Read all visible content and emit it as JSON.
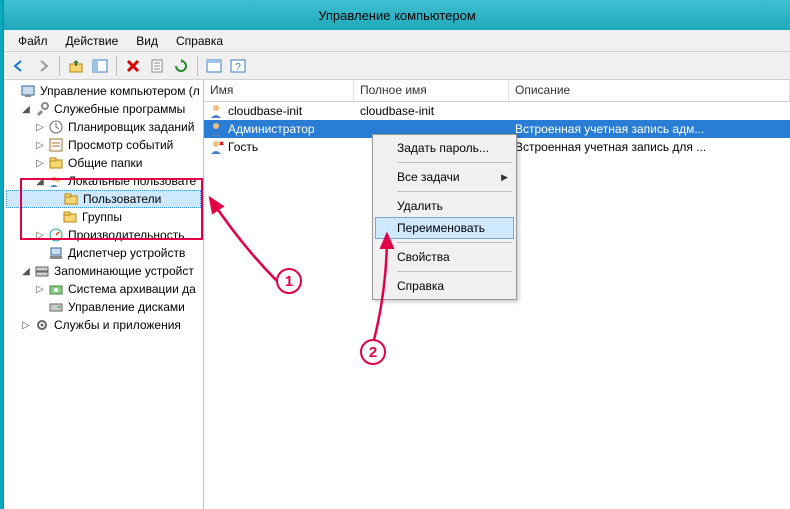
{
  "window": {
    "title": "Управление компьютером"
  },
  "menu": {
    "file": "Файл",
    "action": "Действие",
    "view": "Вид",
    "help": "Справка"
  },
  "tree": {
    "root": "Управление компьютером (л",
    "systools": "Служебные программы",
    "scheduler": "Планировщик заданий",
    "eventviewer": "Просмотр событий",
    "sharedfolders": "Общие папки",
    "localusers": "Локальные пользовате",
    "users": "Пользователи",
    "groups": "Группы",
    "perf": "Производительность",
    "devmgr": "Диспетчер устройств",
    "storage": "Запоминающие устройст",
    "backup": "Система архивации да",
    "diskmgmt": "Управление дисками",
    "services": "Службы и приложения"
  },
  "columns": {
    "name": "Имя",
    "fullname": "Полное имя",
    "description": "Описание"
  },
  "users": [
    {
      "name": "cloudbase-init",
      "fullname": "cloudbase-init",
      "description": ""
    },
    {
      "name": "Администратор",
      "fullname": "",
      "description": "Встроенная учетная запись адм..."
    },
    {
      "name": "Гость",
      "fullname": "",
      "description": "Встроенная учетная запись для ..."
    }
  ],
  "ctx": {
    "setpassword": "Задать пароль...",
    "alltasks": "Все задачи",
    "delete": "Удалить",
    "rename": "Переименовать",
    "properties": "Свойства",
    "help": "Справка"
  },
  "annot": {
    "one": "1",
    "two": "2"
  }
}
